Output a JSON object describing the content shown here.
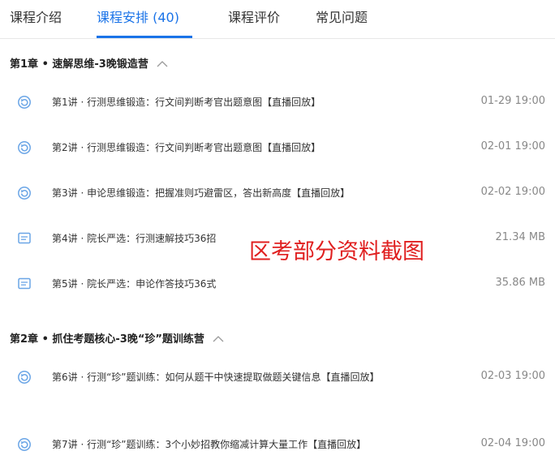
{
  "tabs": [
    {
      "label": "课程介绍",
      "active": false
    },
    {
      "label": "课程安排 (40)",
      "active": true
    },
    {
      "label": "课程评价",
      "active": false
    },
    {
      "label": "常见问题",
      "active": false
    }
  ],
  "chapters": [
    {
      "title": "第1章 • 速解思维-3晚锻造营",
      "lessons": [
        {
          "icon": "replay-icon",
          "title": "第1讲 · 行测思维锻造：行文间判断考官出题意图【直播回放】",
          "meta": "01-29 19:00"
        },
        {
          "icon": "replay-icon",
          "title": "第2讲 · 行测思维锻造：行文间判断考官出题意图【直播回放】",
          "meta": "02-01 19:00"
        },
        {
          "icon": "replay-icon",
          "title": "第3讲 · 申论思维锻造：把握准则巧避雷区，答出新高度【直播回放】",
          "meta": "02-02 19:00"
        },
        {
          "icon": "document-icon",
          "title": "第4讲 · 院长严选：行测速解技巧36招",
          "meta": "21.34 MB"
        },
        {
          "icon": "document-icon",
          "title": "第5讲 · 院长严选：申论作答技巧36式",
          "meta": "35.86 MB"
        }
      ]
    },
    {
      "title": "第2章 • 抓住考题核心-3晚“珍”题训练营",
      "lessons": [
        {
          "icon": "replay-icon",
          "title": "第6讲 · 行测“珍”题训练：如何从题干中快速提取做题关键信息【直播回放】",
          "meta": "02-03 19:00"
        },
        {
          "icon": "replay-icon",
          "title": "第7讲 · 行测“珍”题训练：3个小妙招教你缩减计算大量工作【直播回放】",
          "meta": "02-04 19:00"
        }
      ]
    }
  ],
  "watermark": "区考部分资料截图",
  "colors": {
    "accent": "#1a73e8",
    "icon": "#6aa5e6",
    "watermark": "#e02020"
  }
}
